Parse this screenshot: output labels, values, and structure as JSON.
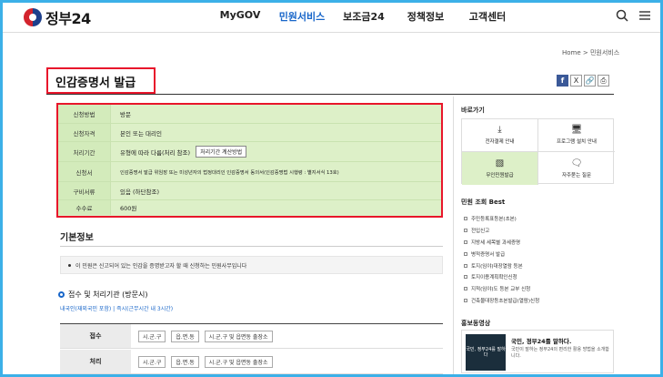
{
  "header": {
    "logo_text": "정부24",
    "nav": [
      "MyGOV",
      "민원서비스",
      "보조금24",
      "정책정보",
      "고객센터"
    ],
    "active_nav_index": 1
  },
  "breadcrumb": "Home > 민원서비스",
  "page": {
    "title": "인감증명서 발급",
    "share_icons": [
      "facebook-icon",
      "x-icon",
      "link-icon",
      "print-icon"
    ]
  },
  "info_table": {
    "rows": [
      {
        "label": "신청방법",
        "value": "방문"
      },
      {
        "label": "신청자격",
        "value": "본인 또는 대리인"
      },
      {
        "label": "처리기간",
        "value": "유형에 따라 다름(처리 참조)",
        "button": "처리기간 계산방법"
      },
      {
        "label": "신청서",
        "value": "인감증명서 발급 위임장 또는 미성년자의 법정대리인 인감증명서 동의서(인감증명법 시행령 : 별지서식 13호)"
      },
      {
        "label": "구비서류",
        "value": "있음 (하단참조)"
      },
      {
        "label": "수수료",
        "value": "600원"
      }
    ]
  },
  "basic": {
    "title": "기본정보",
    "note": "이 민원은 신고되어 있는 인감을 증명받고자 할 때 신청하는 민원사무입니다",
    "reception_title": "접수 및 처리기관 (방문시)",
    "reception_note": "내국인(재외국민 포함) | 즉시(근무시간 내 3시간)",
    "rows": [
      {
        "label": "접수",
        "options": [
          "시.군.구",
          "읍.면.동",
          "시.군.구 및 읍면동 출장소"
        ]
      },
      {
        "label": "처리",
        "options": [
          "시.군.구",
          "읍.면.동",
          "시.군.구 및 읍면동 출장소"
        ]
      }
    ]
  },
  "side": {
    "quick_title": "바로가기",
    "quick_items": [
      {
        "label": "전자결제 안내",
        "icon": "download-icon"
      },
      {
        "label": "프로그램 설치 안내",
        "icon": "monitor-icon"
      },
      {
        "label": "무인민원발급",
        "icon": "kiosk-icon"
      },
      {
        "label": "자주묻는 질문",
        "icon": "chat-icon"
      }
    ],
    "best_title": "민원 조회 Best",
    "best_items": [
      "주민등록표등본(초본)",
      "전입신고",
      "지방세 세목별 과세증명",
      "병적증명서 발급",
      "토지(임야)대장열람 등본",
      "토지이용계획확인신청",
      "지적(임야)도 등본 교부 신청",
      "건축물대장등초본발급(열람)신청"
    ],
    "video_title": "홍보동영상",
    "video_head": "국민, 정부24를 말하다.",
    "video_desc": "국민이 말하는 정부24의 편리한 활용 방법을 소개합니다.",
    "video_thumb": "국민, 정부24를 말하다"
  }
}
